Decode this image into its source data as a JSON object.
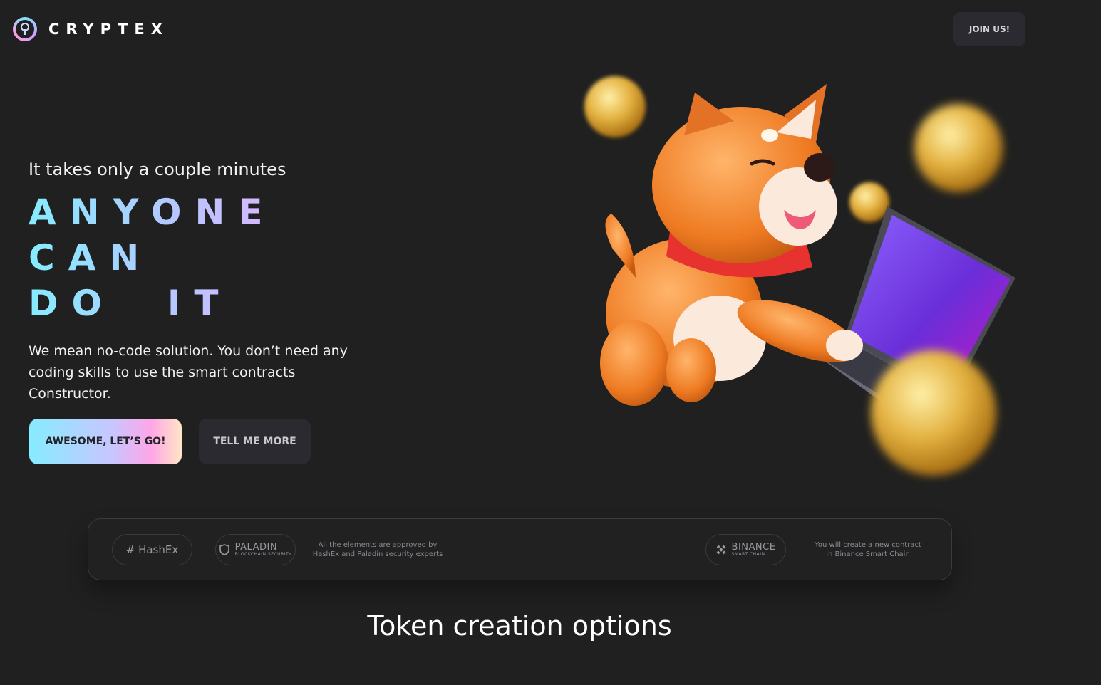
{
  "header": {
    "brand": "CRYPTEX",
    "logo_icon": "keyhole-icon",
    "join_label": "JOIN US!"
  },
  "hero": {
    "subtitle": "It takes only a couple minutes",
    "title_lines": [
      "ANYONE",
      "CAN",
      "DO  IT"
    ],
    "description": "We mean no-code solution. You don’t need any coding skills to use the smart contracts Constructor.",
    "primary_cta": "AWESOME, LET’S GO!",
    "secondary_cta": "TELL ME MORE",
    "illustration": "shiba-dog-with-laptop-and-coins"
  },
  "partners": {
    "hashex": "# HashEx",
    "paladin": "PALADIN",
    "paladin_sub": "BLOCKCHAIN SECURITY",
    "security_note": "All the elements are approved by HashEx and Paladin security experts",
    "binance": "BINANCE",
    "binance_sub": "SMART CHAIN",
    "chain_note": "You will create a new contract in Binance Smart Chain"
  },
  "section": {
    "title": "Token creation options"
  },
  "colors": {
    "background": "#202020",
    "gradient_start": "#86ecff",
    "gradient_end": "#ffa6e6"
  }
}
